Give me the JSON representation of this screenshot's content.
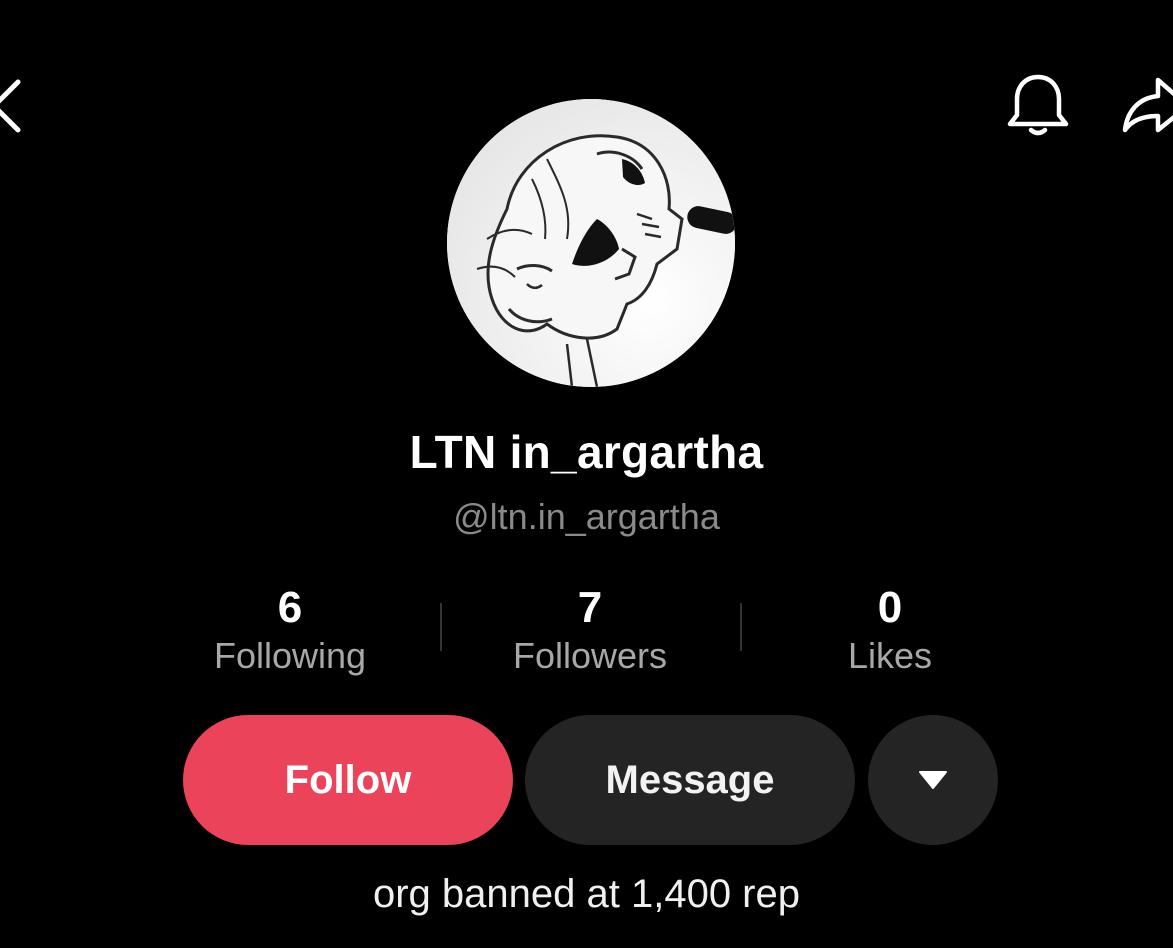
{
  "header": {
    "back_icon": "chevron-left-icon",
    "bell_icon": "bell-icon",
    "share_icon": "share-arrow-icon"
  },
  "profile": {
    "display_name": "LTN in_argartha",
    "username": "@ltn.in_argartha",
    "bio": "org banned at 1,400 rep"
  },
  "stats": {
    "following": {
      "value": "6",
      "label": "Following"
    },
    "followers": {
      "value": "7",
      "label": "Followers"
    },
    "likes": {
      "value": "0",
      "label": "Likes"
    }
  },
  "actions": {
    "follow_label": "Follow",
    "message_label": "Message",
    "more_icon": "caret-down-icon"
  },
  "colors": {
    "background": "#000000",
    "follow_button": "#ea435a",
    "secondary_button": "#242424",
    "muted_text": "#8a8a8a"
  }
}
